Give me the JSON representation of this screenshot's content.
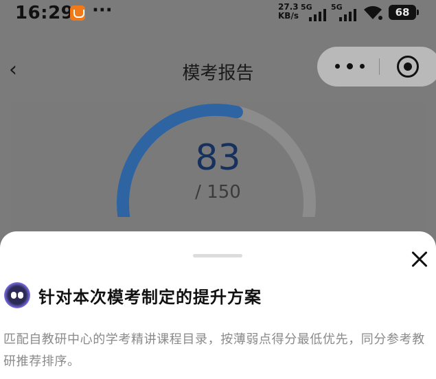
{
  "status_bar": {
    "time": "16:29",
    "more": "···",
    "net_speed_value": "27.3",
    "net_speed_unit": "KB/s",
    "signal1_label": "5G",
    "signal2_label": "5G",
    "battery": "68"
  },
  "nav": {
    "title": "模考报告"
  },
  "score": {
    "value": "83",
    "total": "/ 150",
    "fraction": 0.553
  },
  "colors": {
    "gauge_progress": "#2f64a3",
    "gauge_track": "#8c8c8c",
    "score_text": "#17315e"
  },
  "sheet": {
    "title": "针对本次模考制定的提升方案",
    "description": "匹配自教研中心的学考精讲课程目录，按薄弱点得分最低优先，同分参考教研推荐排序。"
  }
}
